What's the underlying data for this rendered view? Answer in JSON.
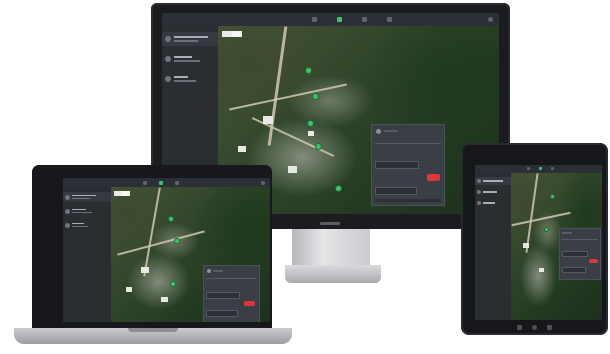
{
  "app": {
    "accent_color": "#3bc46a",
    "alert_color": "#e0353b",
    "brand_label": "",
    "icons": [
      "list-icon",
      "map-pin-icon",
      "settings-icon",
      "search-icon",
      "user-icon"
    ]
  },
  "devices": [
    "monitor",
    "laptop",
    "tablet"
  ],
  "sidebar": {
    "items": [
      {
        "title": "",
        "subtitle": ""
      },
      {
        "title": "",
        "subtitle": ""
      },
      {
        "title": "",
        "subtitle": ""
      }
    ]
  },
  "map": {
    "layer": "satellite",
    "zoom_in_label": "",
    "zoom_out_label": "",
    "marker_count": 5
  },
  "detail_panel": {
    "title": "",
    "action_label": "",
    "message_placeholder": ""
  }
}
